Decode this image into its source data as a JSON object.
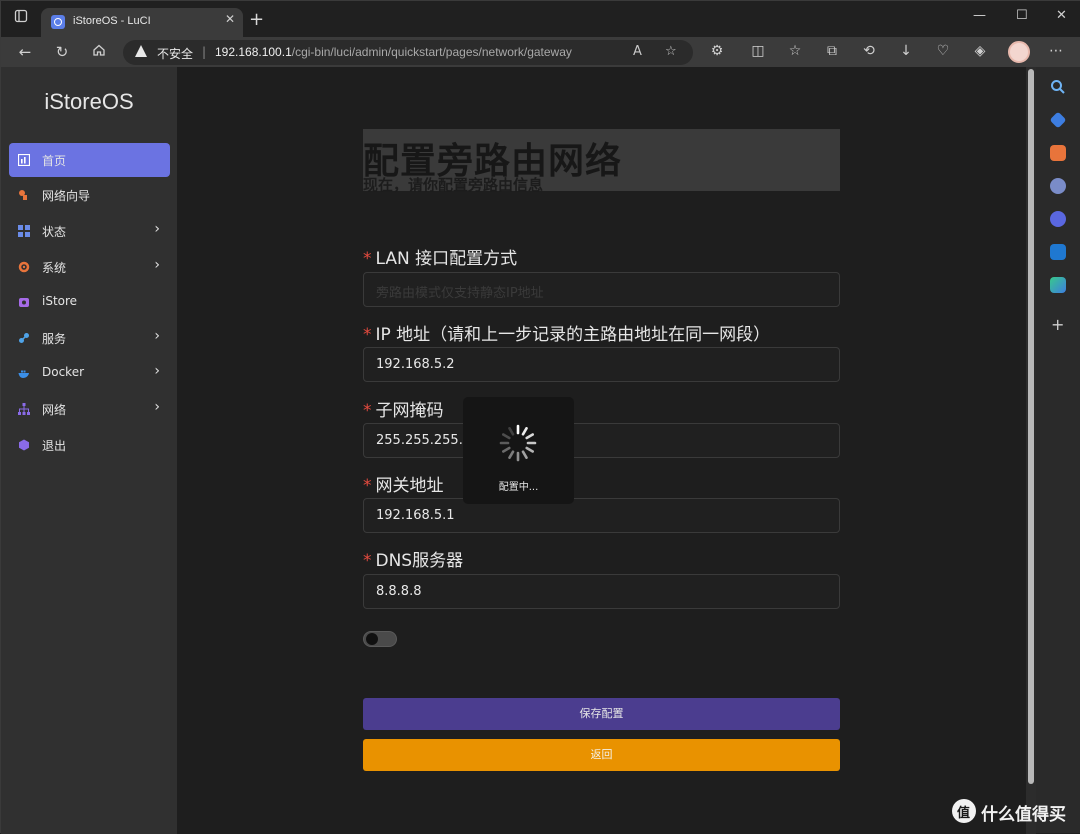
{
  "browser": {
    "tab_title": "iStoreOS - LuCI",
    "security_label": "不安全",
    "url_host": "192.168.100.1",
    "url_path": "/cgi-bin/luci/admin/quickstart/pages/network/gateway",
    "read_aloud_label": "A"
  },
  "sidebar": {
    "logo": "iStoreOS",
    "items": [
      {
        "label": "首页",
        "icon": "dashboard-icon",
        "color": "#ffffff"
      },
      {
        "label": "网络向导",
        "icon": "wizard-icon",
        "color": "#e8743b"
      },
      {
        "label": "状态",
        "icon": "status-icon",
        "color": "#6b8ce8"
      },
      {
        "label": "系统",
        "icon": "gear-icon",
        "color": "#e8743b"
      },
      {
        "label": "iStore",
        "icon": "store-icon",
        "color": "#a66be8"
      },
      {
        "label": "服务",
        "icon": "services-icon",
        "color": "#4fa3e8"
      },
      {
        "label": "Docker",
        "icon": "docker-icon",
        "color": "#3b8fe8"
      },
      {
        "label": "网络",
        "icon": "network-icon",
        "color": "#8a6be8"
      },
      {
        "label": "退出",
        "icon": "logout-icon",
        "color": "#8a6be8"
      }
    ]
  },
  "main": {
    "title": "配置旁路由网络",
    "subtitle": "现在，请你配置旁路由信息",
    "required_mark": "*",
    "fields": {
      "lan_mode": {
        "label": "LAN 接口配置方式",
        "value": "旁路由模式仅支持静态IP地址"
      },
      "ip": {
        "label": "IP 地址（请和上一步记录的主路由地址在同一网段）",
        "value": "192.168.5.2"
      },
      "netmask": {
        "label": "子网掩码",
        "value": "255.255.255.0"
      },
      "gateway": {
        "label": "网关地址",
        "value": "192.168.5.1"
      },
      "dns": {
        "label": "DNS服务器",
        "value": "8.8.8.8"
      }
    },
    "toggle_on": false,
    "save_label": "保存配置",
    "back_label": "返回",
    "loading_text": "配置中..."
  },
  "colors": {
    "accent": "#6b73e2",
    "save_button": "#4b3d8f",
    "back_button": "#e99200",
    "required": "#e54b3f"
  },
  "watermark": "什么值得买"
}
